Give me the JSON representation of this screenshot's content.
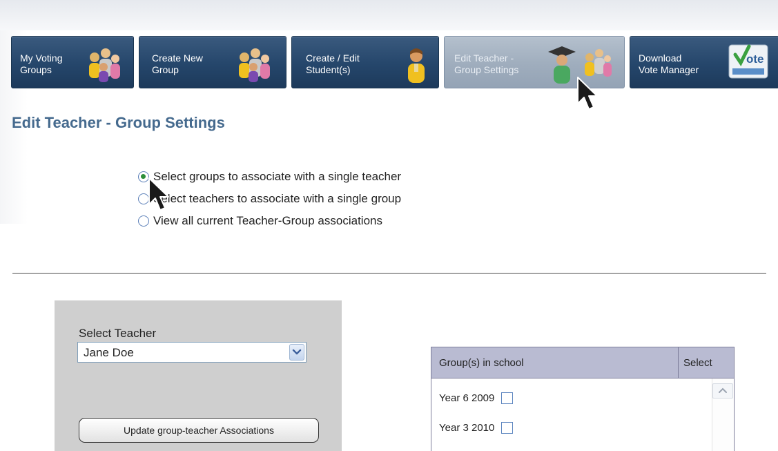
{
  "nav": {
    "buttons": [
      {
        "label": "My Voting\nGroups",
        "icon": "group-icon",
        "active": false
      },
      {
        "label": "Create New\nGroup",
        "icon": "group-icon",
        "active": false
      },
      {
        "label": "Create / Edit\nStudent(s)",
        "icon": "student-icon",
        "active": false
      },
      {
        "label": "Edit Teacher -\nGroup Settings",
        "icon": "teacher-group-icon",
        "active": true
      },
      {
        "label": "Download\nVote Manager",
        "icon": "vote-icon",
        "active": false
      }
    ]
  },
  "page": {
    "title": "Edit Teacher - Group Settings"
  },
  "options": [
    {
      "label": "Select groups to associate with a single teacher",
      "checked": true
    },
    {
      "label": "Select teachers to associate with a single group",
      "checked": false
    },
    {
      "label": "View all current Teacher-Group associations",
      "checked": false
    }
  ],
  "teacher_panel": {
    "select_label": "Select Teacher",
    "selected_teacher": "Jane Doe",
    "update_button": "Update group-teacher Associations"
  },
  "group_table": {
    "headers": [
      "Group(s) in school",
      "Select"
    ],
    "rows": [
      {
        "name": "Year 6 2009",
        "selected": false
      },
      {
        "name": "Year 3 2010",
        "selected": false
      }
    ]
  },
  "colors": {
    "nav_button": "#25466b",
    "nav_active": "#9fadbd",
    "title": "#456a8e",
    "table_header": "#b9bbd2",
    "panel": "#cfcfcf"
  }
}
